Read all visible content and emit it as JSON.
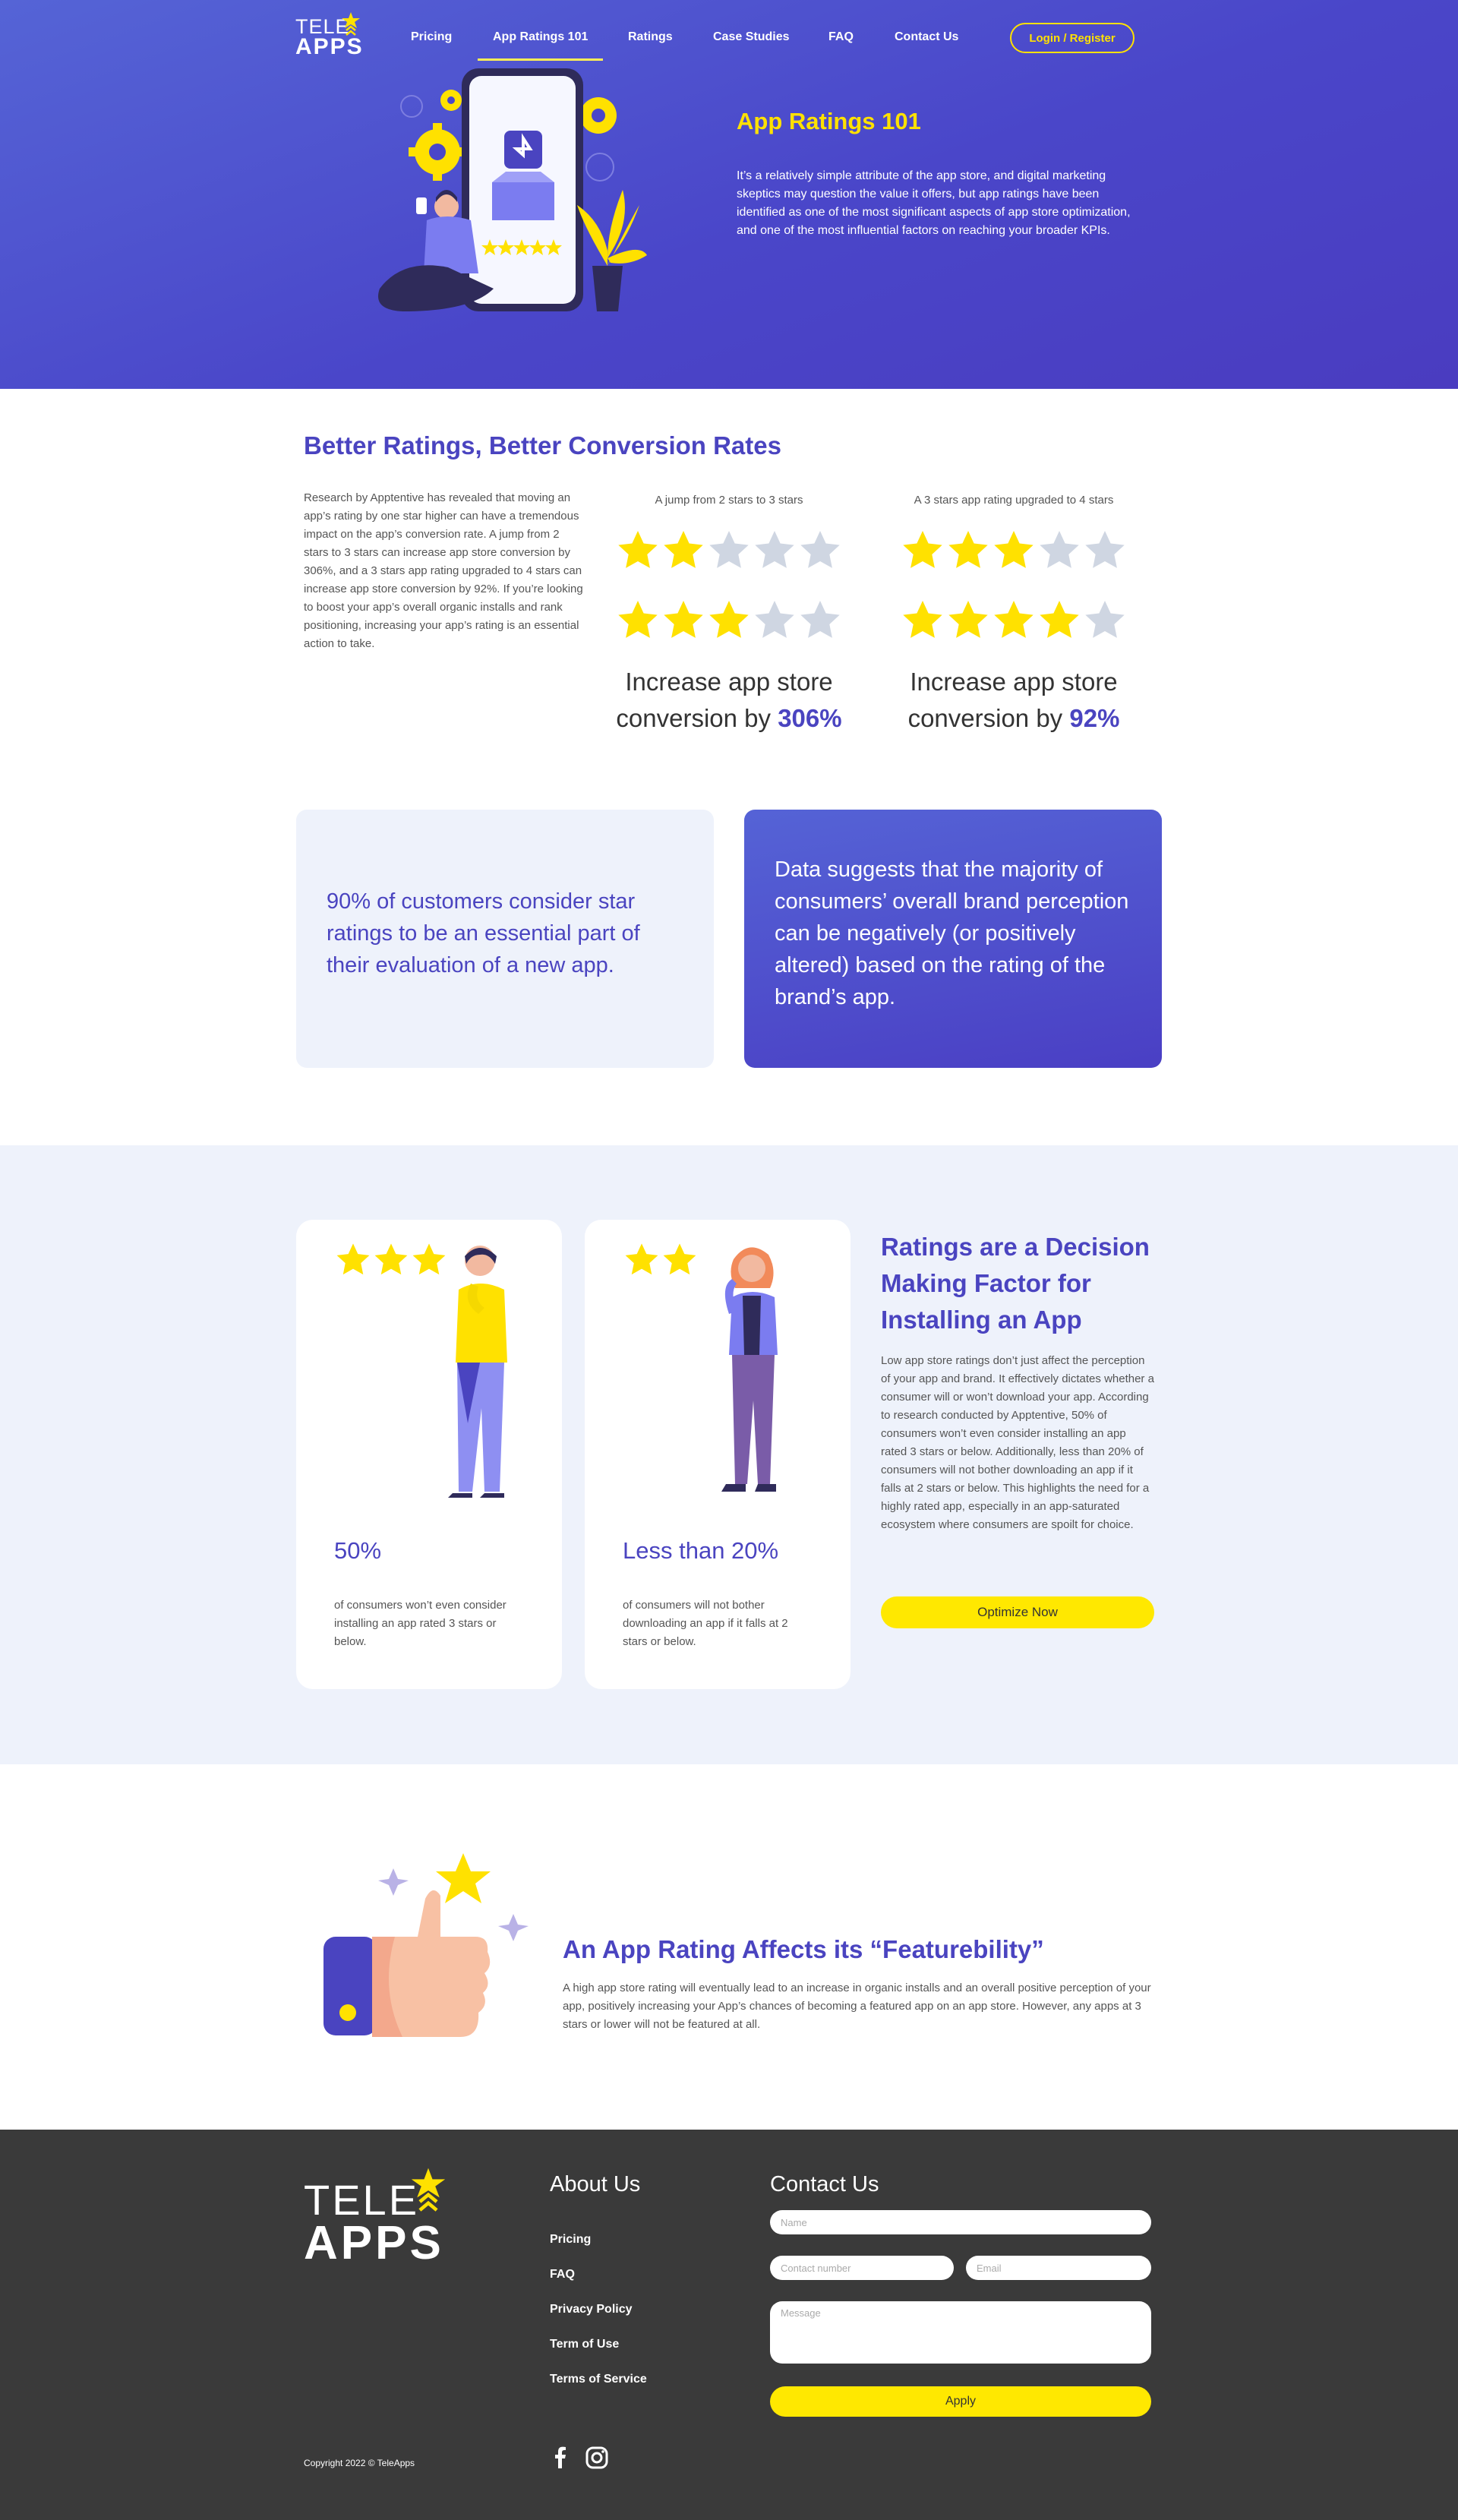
{
  "nav": {
    "logo_line1": "TELE",
    "logo_line2": "APPS",
    "items": [
      "Pricing",
      "App Ratings 101",
      "Ratings",
      "Case Studies",
      "FAQ",
      "Contact Us"
    ],
    "active_index": 1,
    "login_label": "Login / Register"
  },
  "hero": {
    "title": "App Ratings 101",
    "text": "It’s a relatively simple attribute of the app store, and digital marketing skeptics may question the value it offers, but app ratings have been identified as one of the most significant aspects of app store optimization, and one of the most influential factors on reaching your broader KPIs."
  },
  "conversion": {
    "title": "Better Ratings, Better Conversion Rates",
    "text": "Research by Apptentive has revealed that moving an app’s rating by one star higher can have a tremendous impact on the app’s conversion rate. A jump from 2 stars to 3 stars can increase app store conversion by 306%, and a 3 stars app rating upgraded to 4 stars can increase app store conversion by 92%. If you’re looking to boost your app’s overall organic installs and rank positioning, increasing your app’s rating is an essential action to take.",
    "jumps": [
      {
        "label": "A jump from 2 stars to 3 stars",
        "from": 2,
        "to": 3,
        "prefix": "Increase app store conversion by",
        "value": "306%"
      },
      {
        "label": "A 3 stars app rating upgraded to 4 stars",
        "from": 3,
        "to": 4,
        "prefix": "Increase app store conversion by",
        "value": "92%"
      }
    ]
  },
  "callouts": {
    "light": "90% of customers consider star ratings to be an essential part of their evaluation of a new app.",
    "dark": "Data suggests that the majority of consumers’ overall brand perception can be negatively (or positively altered) based on the rating of the brand’s app."
  },
  "decision": {
    "cards": [
      {
        "stars": 3,
        "stat": "50%",
        "desc": "of consumers won’t even consider installing an app rated 3 stars or below."
      },
      {
        "stars": 2,
        "stat": "Less than 20%",
        "desc": "of consumers will not bother downloading an app if it falls at 2 stars or below."
      }
    ],
    "title": "Ratings are a Decision Making Factor for Installing an App",
    "text": "Low app store ratings don’t just affect the perception of your app and brand. It effectively dictates whether a consumer will or won’t download your app. According to research conducted by Apptentive, 50% of consumers won’t even consider installing an app rated 3 stars or below. Additionally, less than 20% of consumers will not bother downloading an app if it falls at 2 stars or below. This highlights the need for a highly rated app, especially in an app-saturated ecosystem where consumers are spoilt for choice.",
    "button": "Optimize Now"
  },
  "feature": {
    "title": "An App Rating Affects its “Featurebility”",
    "text": "A high app store rating will eventually lead to an increase in organic installs and an overall positive perception of your app, positively increasing your App’s chances of becoming a featured app on an app store. However, any apps at 3 stars or lower will not be featured at all."
  },
  "footer": {
    "about_title": "About Us",
    "links": [
      "Pricing",
      "FAQ",
      "Privacy Policy",
      "Term of Use",
      "Terms of Service"
    ],
    "contact_title": "Contact Us",
    "placeholders": {
      "name": "Name",
      "phone": "Contact number",
      "email": "Email",
      "message": "Message"
    },
    "apply": "Apply",
    "copyright": "Copyright 2022 © TeleApps",
    "social": [
      "facebook-icon",
      "instagram-icon"
    ]
  },
  "colors": {
    "brand_purple": "#4a44c0",
    "accent_yellow": "#ffe100",
    "light_bg": "#eef2fb",
    "footer_bg": "#3a3a3a",
    "star_off": "#cfd6e2"
  }
}
